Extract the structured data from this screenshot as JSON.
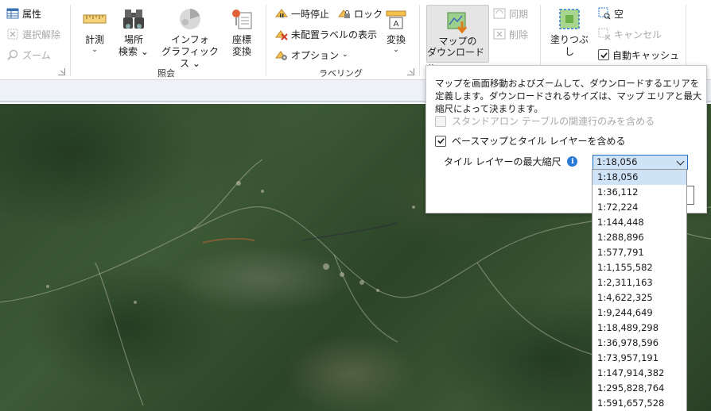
{
  "ribbon": {
    "groups": {
      "query": "照会",
      "labeling": "ラベリング"
    },
    "selection": {
      "attributes": "属性",
      "clear_selection": "選択解除",
      "zoom": "ズーム"
    },
    "query": {
      "measure": "計測",
      "locate_line1": "場所",
      "locate_line2": "検索",
      "infographics_line1": "インフォ",
      "infographics_line2": "グラフィックス",
      "coordinate_line1": "座標",
      "coordinate_line2": "変換"
    },
    "labeling": {
      "pause": "一時停止",
      "lock": "ロック",
      "unplaced": "未配置ラベルの表示",
      "options": "オプション",
      "convert": "変換"
    },
    "offline": {
      "download_line1": "マップの",
      "download_line2": "ダウンロード",
      "sync": "同期",
      "remove": "削除"
    },
    "graphics": {
      "fill": "塗りつぶし",
      "empty": "空",
      "cancel": "キャンセル",
      "auto_cache": "自動キャッシュ"
    }
  },
  "popup": {
    "description": "マップを画面移動およびズームして、ダウンロードするエリアを定義します。ダウンロードされるサイズは、マップ エリアと最大縮尺によって決まります。",
    "standalone_tables": "スタンドアロン テーブルの関連行のみを含める",
    "include_basemap": "ベースマップとタイル レイヤーを含める",
    "max_scale_label": "タイル レイヤーの最大縮尺",
    "selected_scale": "1:18,056",
    "scale_options": [
      "1:18,056",
      "1:36,112",
      "1:72,224",
      "1:144,448",
      "1:288,896",
      "1:577,791",
      "1:1,155,582",
      "1:2,311,163",
      "1:4,622,325",
      "1:9,244,649",
      "1:18,489,298",
      "1:36,978,596",
      "1:73,957,191",
      "1:147,914,382",
      "1:295,828,764",
      "1:591,657,528"
    ]
  }
}
